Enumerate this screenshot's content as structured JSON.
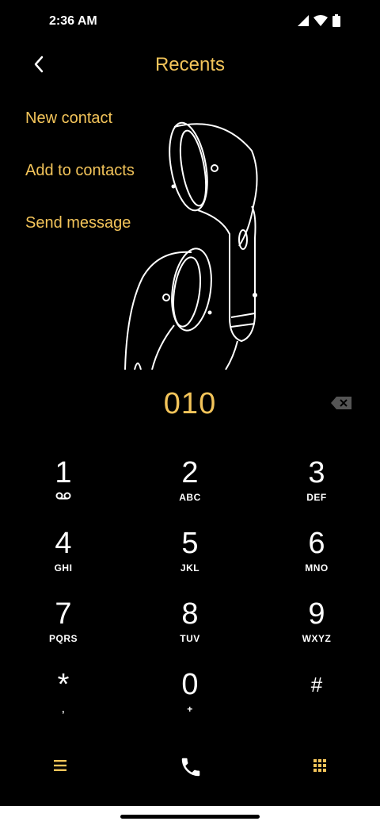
{
  "status": {
    "time": "2:36 AM"
  },
  "header": {
    "title": "Recents"
  },
  "menu": [
    {
      "label": "New contact"
    },
    {
      "label": "Add to contacts"
    },
    {
      "label": "Send message"
    }
  ],
  "dialpad": {
    "dialed_number": "010",
    "keys": [
      {
        "digit": "1",
        "letters": ""
      },
      {
        "digit": "2",
        "letters": "ABC"
      },
      {
        "digit": "3",
        "letters": "DEF"
      },
      {
        "digit": "4",
        "letters": "GHI"
      },
      {
        "digit": "5",
        "letters": "JKL"
      },
      {
        "digit": "6",
        "letters": "MNO"
      },
      {
        "digit": "7",
        "letters": "PQRS"
      },
      {
        "digit": "8",
        "letters": "TUV"
      },
      {
        "digit": "9",
        "letters": "WXYZ"
      },
      {
        "digit": "*",
        "letters": ","
      },
      {
        "digit": "0",
        "letters": "+"
      },
      {
        "digit": "#",
        "letters": ""
      }
    ]
  },
  "colors": {
    "accent": "#f3c45a",
    "background": "#000000"
  },
  "icons": {
    "back": "back-arrow-icon",
    "backspace": "backspace-icon",
    "voicemail": "voicemail-icon",
    "menu": "menu-icon",
    "call": "call-icon",
    "dialpad": "dialpad-icon"
  }
}
